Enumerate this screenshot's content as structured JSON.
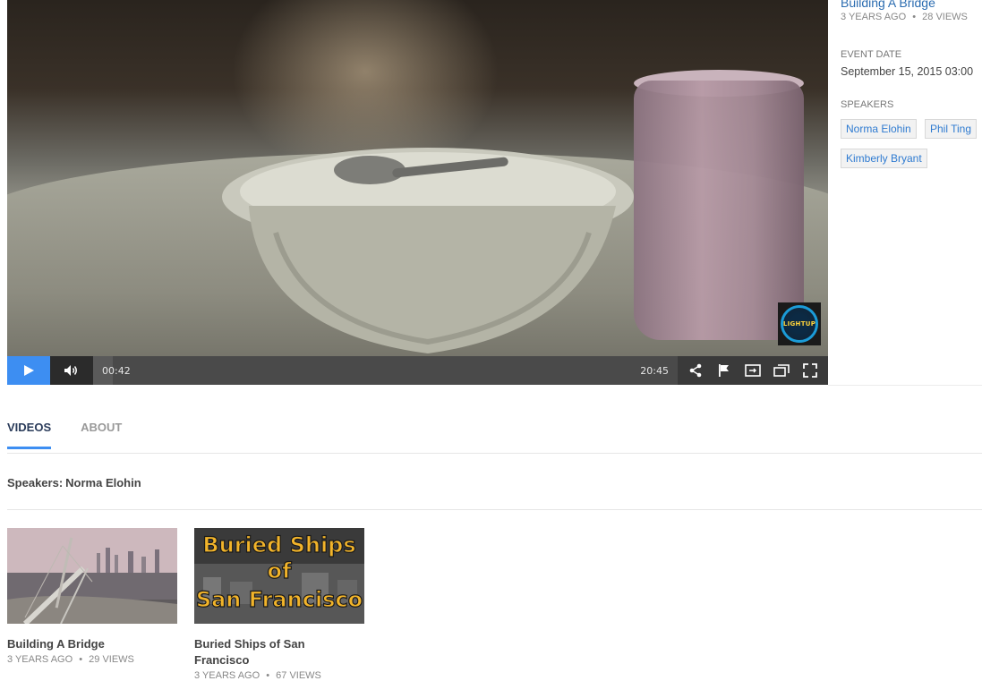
{
  "player": {
    "current_time": "00:42",
    "duration": "20:45",
    "progress_fraction": 0.034,
    "logo_text": "LIGHTUP",
    "accent_color": "#3d8ef2"
  },
  "sidebar": {
    "title": "Building A Bridge",
    "age": "3 YEARS AGO",
    "views": "28 VIEWS",
    "event_date_label": "EVENT DATE",
    "event_date_value": "September 15, 2015 03:00",
    "speakers_label": "SPEAKERS",
    "speakers": [
      "Norma Elohin",
      "Phil Ting",
      "Kimberly Bryant"
    ]
  },
  "tabs": [
    {
      "label": "VIDEOS",
      "active": true
    },
    {
      "label": "ABOUT",
      "active": false
    }
  ],
  "filter": {
    "label": "Speakers:",
    "value": "Norma Elohin"
  },
  "videos": [
    {
      "title": "Building A Bridge",
      "age": "3 YEARS AGO",
      "views": "29 VIEWS"
    },
    {
      "title": "Buried Ships of San Francisco",
      "title_line1": "Buried Ships of San",
      "title_line2": "Francisco",
      "age": "3 YEARS AGO",
      "views": "67 VIEWS",
      "thumb_text_1": "Buried Ships",
      "thumb_text_2": "of",
      "thumb_text_3": "San Francisco"
    }
  ],
  "separator": "•",
  "icons": {
    "play": "play-icon",
    "volume": "volume-icon",
    "share": "share-icon",
    "flag": "flag-icon",
    "theater": "theater-mode-icon",
    "popout": "popout-icon",
    "fullscreen": "fullscreen-icon"
  }
}
